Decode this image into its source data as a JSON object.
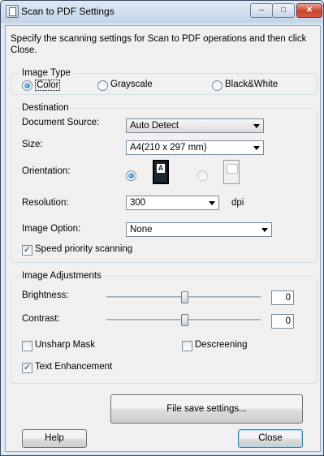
{
  "window": {
    "title": "Scan to PDF Settings",
    "minimize": "–",
    "maximize": "□",
    "close": "✕"
  },
  "intro": "Specify the scanning settings for Scan to PDF operations and then click Close.",
  "image_type": {
    "legend": "Image Type",
    "options": [
      {
        "label": "Color",
        "selected": true
      },
      {
        "label": "Grayscale",
        "selected": false
      },
      {
        "label": "Black&White",
        "selected": false
      }
    ]
  },
  "destination": {
    "legend": "Destination",
    "document_source_label": "Document Source:",
    "document_source_value": "Auto Detect",
    "size_label": "Size:",
    "size_value": "A4(210 x 297 mm)",
    "orientation_label": "Orientation:",
    "resolution_label": "Resolution:",
    "resolution_value": "300",
    "resolution_unit": "dpi",
    "image_option_label": "Image Option:",
    "image_option_value": "None",
    "speed_priority_label": "Speed priority scanning",
    "speed_priority_checked": true
  },
  "adjustments": {
    "legend": "Image Adjustments",
    "brightness_label": "Brightness:",
    "brightness_value": "0",
    "contrast_label": "Contrast:",
    "contrast_value": "0",
    "unsharp_label": "Unsharp Mask",
    "descreening_label": "Descreening",
    "text_enh_label": "Text Enhancement"
  },
  "buttons": {
    "file_save": "File save settings...",
    "help": "Help",
    "close": "Close"
  }
}
